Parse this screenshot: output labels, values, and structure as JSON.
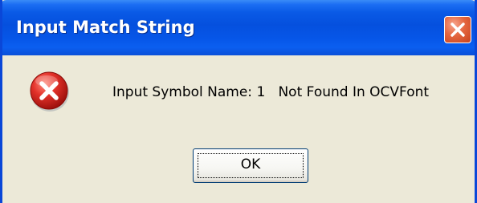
{
  "window": {
    "title": "Input Match String"
  },
  "dialog": {
    "icon": "error-icon",
    "message": "Input Symbol Name: 1   Not Found In OCVFont",
    "ok_label": "OK"
  },
  "colors": {
    "titlebar": "#0550de",
    "client_background": "#ece9d8",
    "close_button": "#e4663f",
    "error_icon": "#d1231f"
  }
}
